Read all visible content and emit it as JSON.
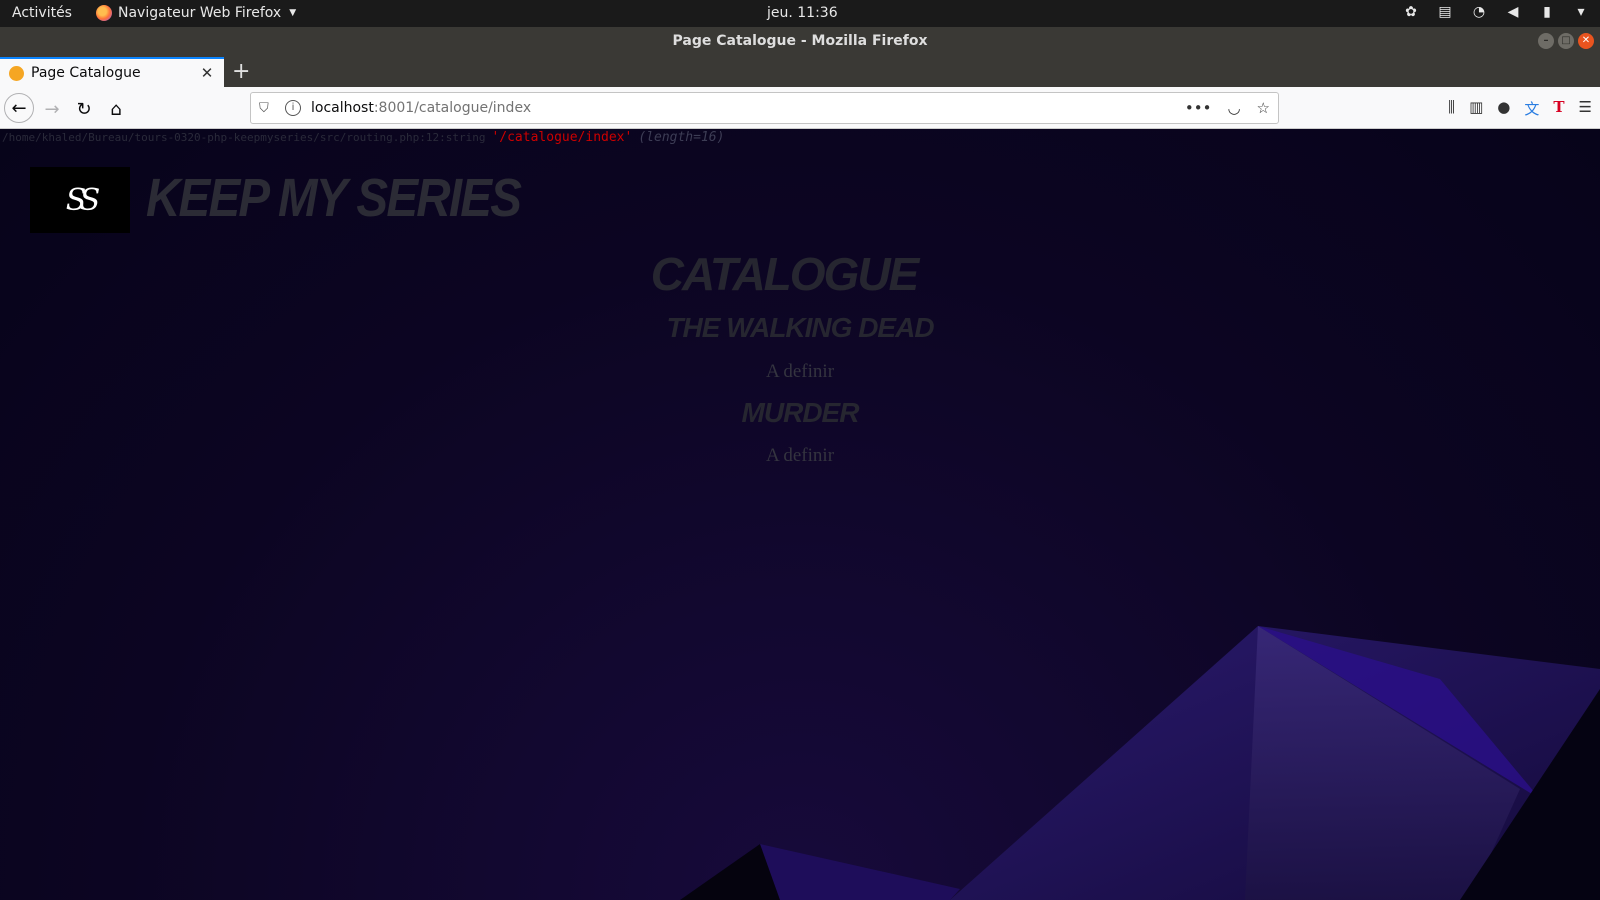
{
  "topbar": {
    "activities": "Activités",
    "app_name": "Navigateur Web Firefox",
    "clock": "jeu. 11:36"
  },
  "window": {
    "title": "Page Catalogue - Mozilla Firefox"
  },
  "tabs": [
    {
      "label": "Page Catalogue",
      "active": true
    }
  ],
  "urlbar": {
    "host": "localhost",
    "rest": ":8001/catalogue/index"
  },
  "debug": {
    "path": "/home/khaled/Bureau/tours-0320-php-keepmyseries/src/routing.php:12:string",
    "value": "'/catalogue/index'",
    "length": "(length=16)"
  },
  "site": {
    "logo_text": "SS",
    "brand": "Keep my series"
  },
  "catalogue": {
    "heading": "Catalogue",
    "series": [
      {
        "title": "The walking dead",
        "description": "A definir"
      },
      {
        "title": "Murder",
        "description": "A definir"
      }
    ]
  },
  "colors": {
    "background": "#0c0522",
    "accent_purple": "#2a1a6e",
    "debug_string": "#cc0000"
  }
}
